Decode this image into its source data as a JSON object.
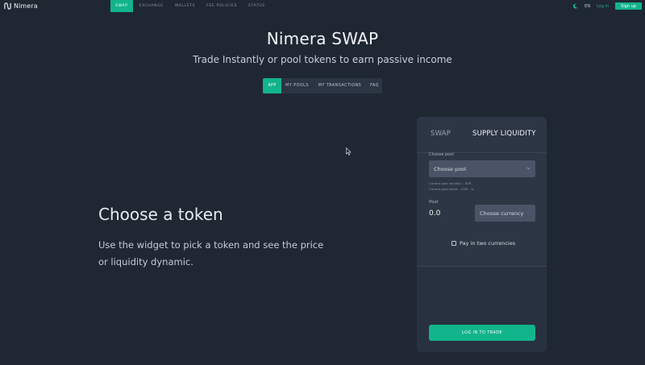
{
  "brand": {
    "name": "Nimera"
  },
  "nav": {
    "items": [
      {
        "label": "SWAP",
        "active": true
      },
      {
        "label": "EXCHANGE",
        "active": false
      },
      {
        "label": "WALLETS",
        "active": false
      },
      {
        "label": "FEE POLICIES",
        "active": false
      },
      {
        "label": "STATUS",
        "active": false
      }
    ],
    "language": "EN",
    "login_label": "Log in",
    "signup_label": "Sign up"
  },
  "hero": {
    "title": "Nimera SWAP",
    "subtitle": "Trade Instantly or pool tokens to earn passive income"
  },
  "subtabs": [
    {
      "label": "APP",
      "active": true
    },
    {
      "label": "MY POOLS",
      "active": false
    },
    {
      "label": "MY TRANSACTIONS",
      "active": false
    },
    {
      "label": "FAQ",
      "active": false
    }
  ],
  "intro": {
    "title": "Choose a token",
    "description": "Use the widget to pick a token and see the price or liquidity dynamic."
  },
  "widget": {
    "tabs": [
      {
        "label": "SWAP",
        "active": false
      },
      {
        "label": "SUPPLY LIQUIDITY",
        "active": true
      }
    ],
    "choose_pool_label": "Choose pool",
    "choose_pool_placeholder": "Choose pool",
    "current_pool_liquidity": "Current pool liquidity: - EUR",
    "current_pool_share": "Current pool share: - EUR - %",
    "pool_label": "Pool",
    "pool_value": "0.0",
    "choose_currency_placeholder": "Choose currency",
    "pay_two_currencies_label": "Pay in two currencies",
    "pay_two_currencies_checked": false,
    "login_to_trade_label": "LOG IN TO TRADE"
  },
  "colors": {
    "background": "#1f2733",
    "accent": "#12b48b",
    "panel": "#2d3644",
    "input": "#4a5466"
  }
}
